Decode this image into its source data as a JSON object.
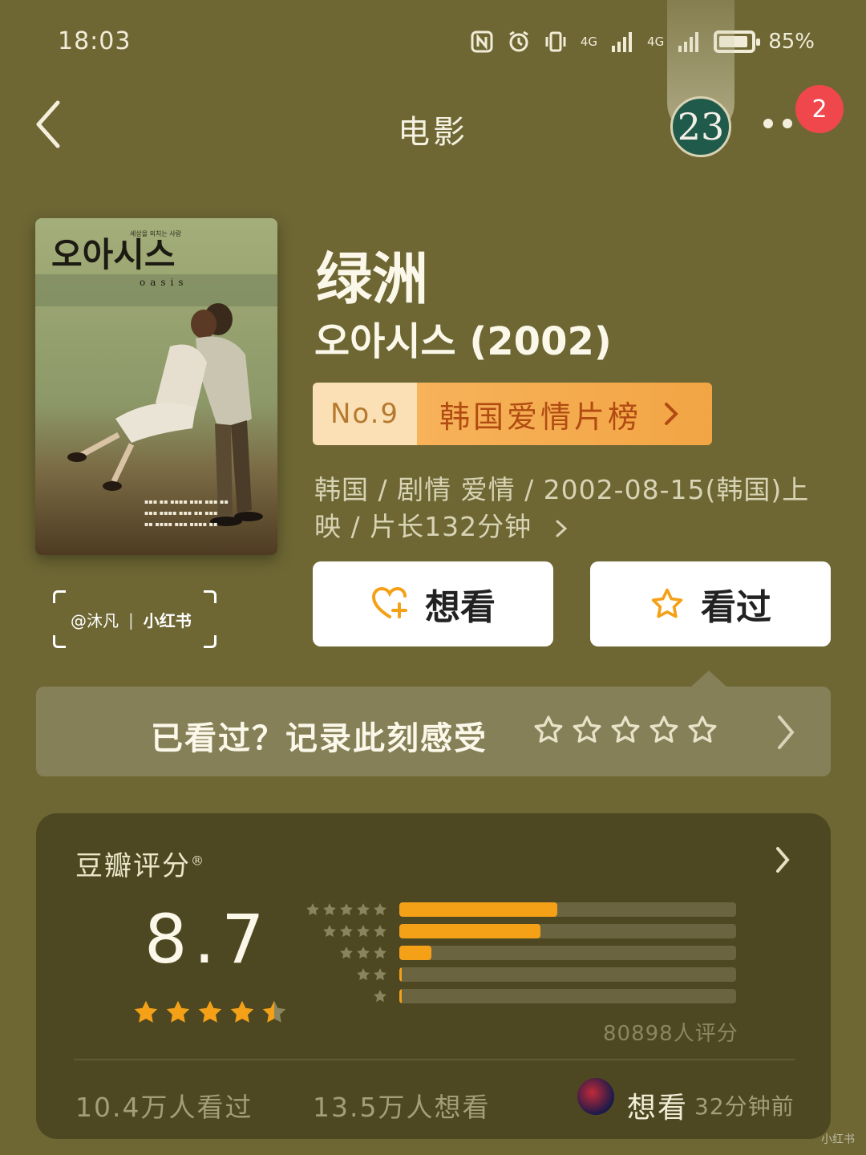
{
  "status_bar": {
    "time": "18:03",
    "network_1": "4G",
    "network_2": "4G",
    "battery": "85%",
    "icons": [
      "nfc-icon",
      "alarm-icon",
      "vibrate-icon",
      "signal-icon",
      "signal-icon",
      "battery-icon"
    ]
  },
  "nav": {
    "title": "电影",
    "avatar_label": "23",
    "notification_count": "2"
  },
  "movie": {
    "title": "绿洲",
    "original_title": "오아시스 (2002)",
    "rank_no": "No.9",
    "rank_list": "韩国爱情片榜",
    "meta": "韩国 / 剧情 爱情 / 2002-08-15(韩国)上映 / 片长132分钟",
    "poster": {
      "title": "오아시스",
      "subtitle": "oasis",
      "tagline": "세상을 외치는 사랑"
    }
  },
  "watermark": {
    "user": "@沐凡",
    "brand": "小红书"
  },
  "actions": {
    "want_label": "想看",
    "seen_label": "看过"
  },
  "record": {
    "prompt": "已看过？记录此刻感受",
    "stars": 5
  },
  "rating": {
    "label": "豆瓣评分",
    "registered": "®",
    "score": "8.7",
    "stars": 4.5,
    "count_text": "80898人评分",
    "distribution": [
      {
        "stars": 5,
        "fraction": 0.47
      },
      {
        "stars": 4,
        "fraction": 0.42
      },
      {
        "stars": 3,
        "fraction": 0.095
      },
      {
        "stars": 2,
        "fraction": 0.008
      },
      {
        "stars": 1,
        "fraction": 0.004
      }
    ],
    "seen_count": "10.4万人看过",
    "want_count": "13.5万人想看",
    "friend_action": "想看",
    "friend_time": "32分钟前"
  },
  "colors": {
    "background": "#6e6734",
    "card": "#4e4822",
    "accent_orange": "#f5a118",
    "badge_red": "#f0474d"
  }
}
